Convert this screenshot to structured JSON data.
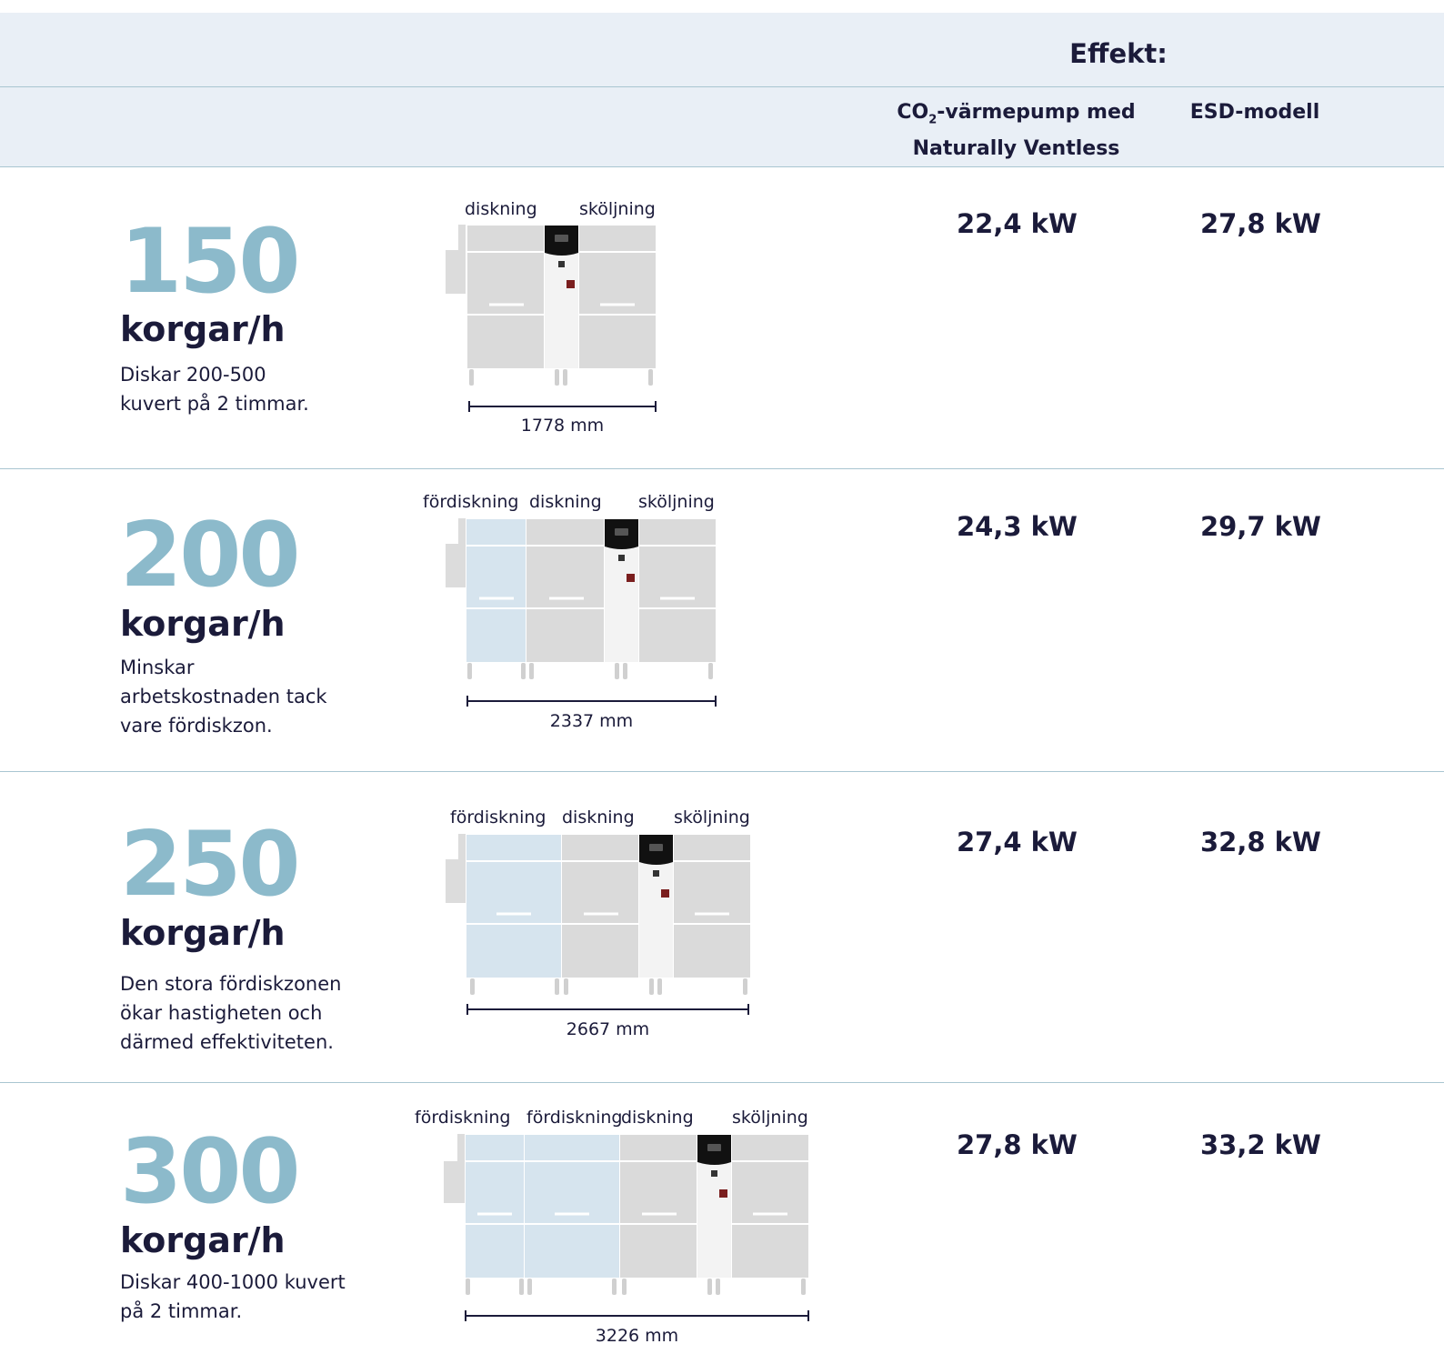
{
  "header": {
    "title": "Effekt:",
    "col_co2_prefix": "CO",
    "col_co2_sub": "2",
    "col_co2_rest": "-värmepump med",
    "col_co2_line2": "Naturally Ventless",
    "col_esd": "ESD-modell"
  },
  "colors": {
    "accent_number": "#8cbacb",
    "dark_text": "#1b1b3a",
    "header_bg": "#e9eff6",
    "prewash_zone": "#d6e4ee",
    "wash_zone": "#dadada",
    "control_panel": "#111111"
  },
  "rows": [
    {
      "number": "150",
      "unit": "korgar/h",
      "description": "Diskar 200-500\nkuvert på 2 timmar.",
      "zones": [
        "diskning",
        "sköljning"
      ],
      "length": "1778 mm",
      "co2_kw": "22,4 kW",
      "esd_kw": "27,8 kW"
    },
    {
      "number": "200",
      "unit": "korgar/h",
      "description": "Minskar\narbetskostnaden tack\nvare fördiskzon.",
      "zones": [
        "fördiskning",
        "diskning",
        "sköljning"
      ],
      "length": "2337 mm",
      "co2_kw": "24,3 kW",
      "esd_kw": "29,7 kW"
    },
    {
      "number": "250",
      "unit": "korgar/h",
      "description": "Den stora fördiskzonen\nökar hastigheten och\ndärmed effektiviteten.",
      "zones": [
        "fördiskning",
        "diskning",
        "sköljning"
      ],
      "length": "2667 mm",
      "co2_kw": "27,4 kW",
      "esd_kw": "32,8 kW"
    },
    {
      "number": "300",
      "unit": "korgar/h",
      "description": "Diskar 400-1000 kuvert\npå 2 timmar.",
      "zones": [
        "fördiskning",
        "fördiskning",
        "diskning",
        "sköljning"
      ],
      "length": "3226 mm",
      "co2_kw": "27,8 kW",
      "esd_kw": "33,2 kW"
    }
  ]
}
